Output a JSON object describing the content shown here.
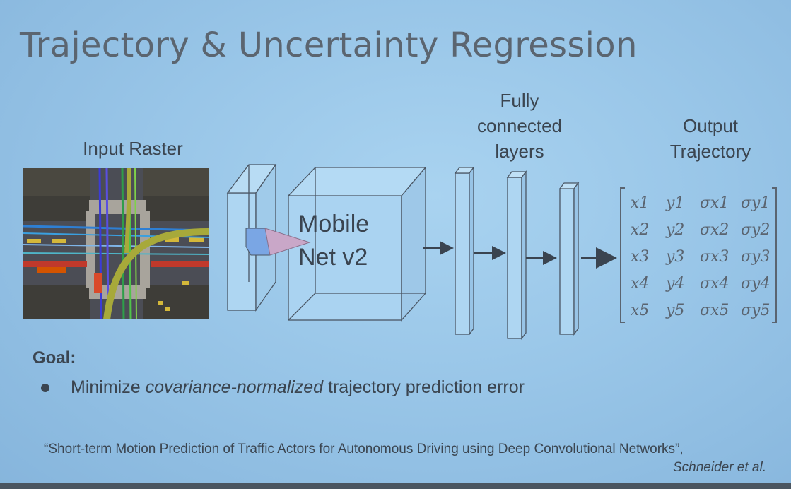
{
  "slide": {
    "title": "Trajectory & Uncertainty Regression",
    "input_label": "Input Raster",
    "fc_label_lines": [
      "Fully",
      "connected",
      "layers"
    ],
    "output_label_lines": [
      "Output",
      "Trajectory"
    ],
    "network_label_lines": [
      "Mobile",
      "Net v2"
    ],
    "goal_title": "Goal:",
    "goal_bullet": {
      "prefix": "Minimize ",
      "emphasis": "covariance-normalized",
      "suffix": " trajectory prediction error"
    },
    "citation": "“Short-term Motion Prediction of Traffic Actors for Autonomous Driving using Deep Convolutional Networks”,",
    "authors": "Schneider et al."
  },
  "output_matrix": [
    [
      "x1",
      "y1",
      "σx1",
      "σy1"
    ],
    [
      "x2",
      "y2",
      "σx2",
      "σy2"
    ],
    [
      "x3",
      "y3",
      "σx3",
      "σy3"
    ],
    [
      "x4",
      "y4",
      "σx4",
      "σy4"
    ],
    [
      "x5",
      "y5",
      "σx5",
      "σy5"
    ]
  ],
  "colors": {
    "background": "#9ccbec",
    "text": "#3b4550",
    "title": "#5b6570",
    "diagram_line": "#4a5664",
    "raster_road": "#a8a49c",
    "raster_trajectory": "#a7a93a"
  }
}
